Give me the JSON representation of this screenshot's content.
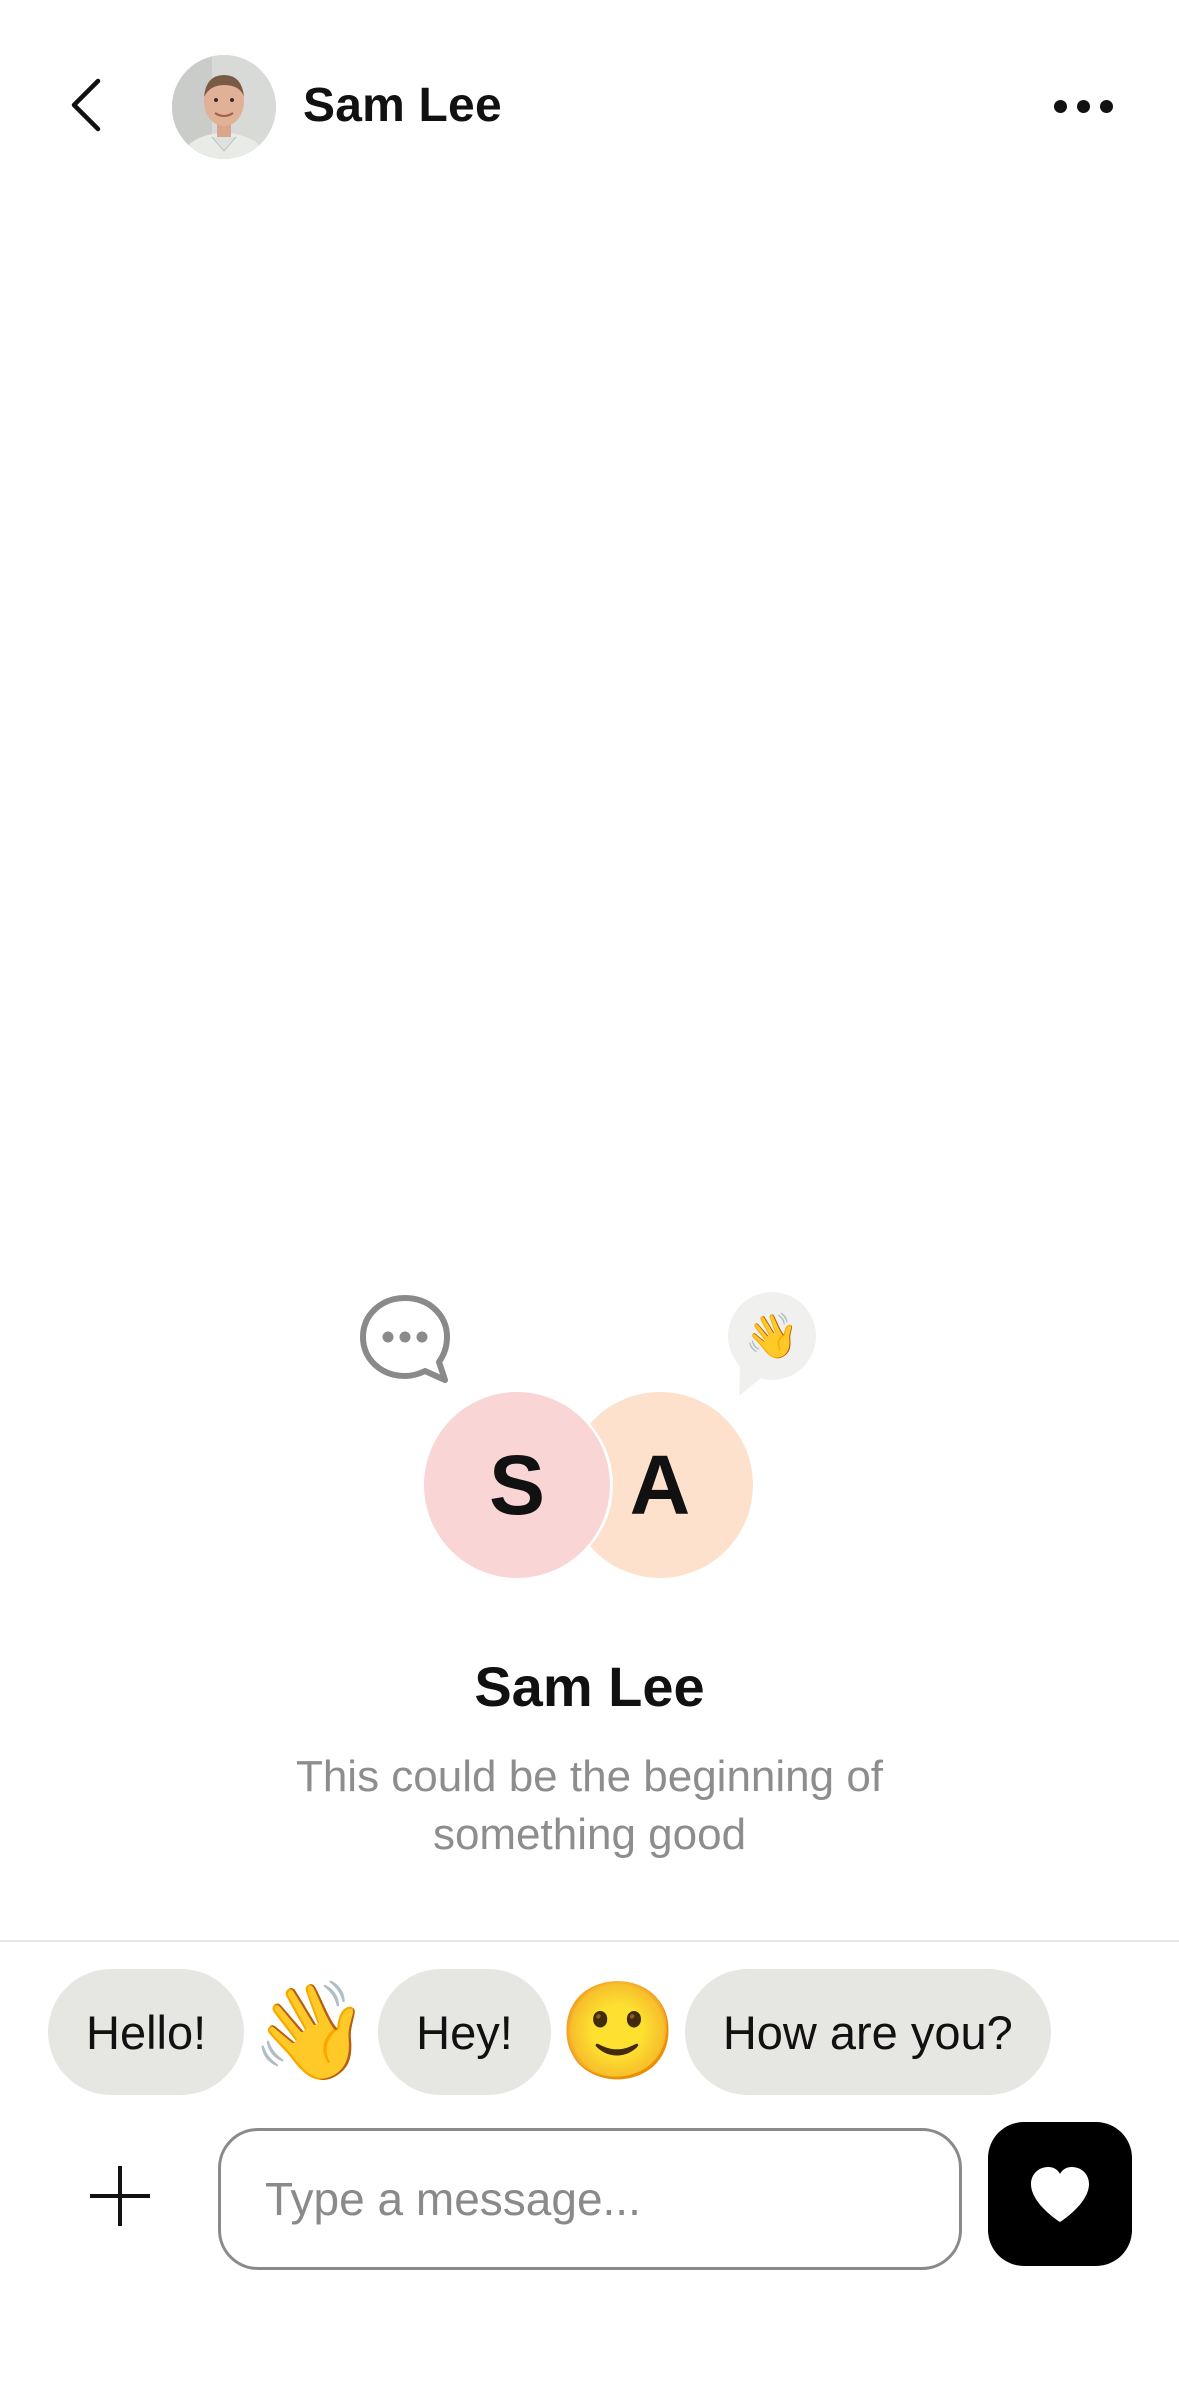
{
  "header": {
    "name": "Sam Lee",
    "back_icon": "chevron-left-icon",
    "more_icon": "more-horizontal-icon"
  },
  "intro": {
    "left_initial": "S",
    "right_initial": "A",
    "name": "Sam Lee",
    "subtitle": "This could be the beginning of something good",
    "wave_emoji": "👋",
    "left_circle_color": "#f9d5d5",
    "right_circle_color": "#fde1cd"
  },
  "quick_replies": [
    {
      "type": "text",
      "label": "Hello!"
    },
    {
      "type": "emoji",
      "label": "👋"
    },
    {
      "type": "text",
      "label": "Hey!"
    },
    {
      "type": "emoji",
      "label": "🙂"
    },
    {
      "type": "text",
      "label": "How are you?"
    }
  ],
  "composer": {
    "placeholder": "Type a message...",
    "value": "",
    "add_icon": "plus-icon",
    "send_icon": "heart-icon"
  },
  "colors": {
    "chip_bg": "#e6e6e3",
    "placeholder_text": "#8a8a8a",
    "send_button_bg": "#000000"
  }
}
